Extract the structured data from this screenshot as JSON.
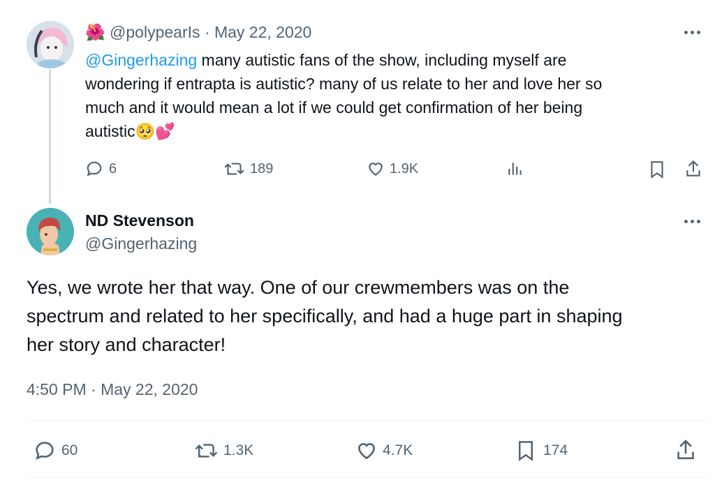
{
  "reply_tweet": {
    "emoji": "🌺",
    "handle": "@polypearIs",
    "separator": "·",
    "date": "May 22, 2020",
    "mention": "@Gingerhazing",
    "text_line1": " many autistic fans of the show, including myself are",
    "text_line2": "wondering if entrapta is autistic? many of us relate to her and love her so",
    "text_line3": "much and it would mean a lot if we could get confirmation of her being",
    "text_line4": "autistic",
    "text_emoji": "🥺💕",
    "actions": {
      "replies": "6",
      "retweets": "189",
      "likes": "1.9K",
      "views_icon": "bar-chart-icon",
      "bookmark_icon": "bookmark-icon",
      "share_icon": "share-icon"
    }
  },
  "main_tweet": {
    "display_name": "ND Stevenson",
    "handle": "@Gingerhazing",
    "text_line1": "Yes, we wrote her that way. One of our crewmembers was on the",
    "text_line2": "spectrum and related to her specifically, and had a huge part in shaping",
    "text_line3": "her story and character!",
    "timestamp": "4:50 PM · May 22, 2020",
    "actions": {
      "replies": "60",
      "retweets": "1.3K",
      "likes": "4.7K",
      "bookmarks": "174",
      "share_icon": "share-icon"
    }
  },
  "colors": {
    "link": "#1d9bf0",
    "text": "#0f1419",
    "muted": "#536471",
    "thread_line": "#cfd9de"
  }
}
